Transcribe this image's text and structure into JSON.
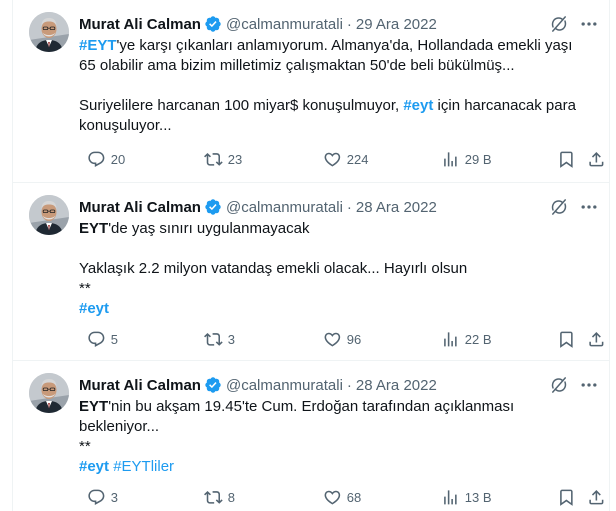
{
  "tweets": [
    {
      "name": "Murat Ali Calman",
      "handle": "@calmanmuratali",
      "separator": "·",
      "date": "29 Ara 2022",
      "body": {
        "l1_tag": "#EYT",
        "l1_rest": "'ye karşı çıkanları anlamıyorum. Almanya'da, Hollandada emekli yaşı",
        "l2": "65 olabilir ama bizim milletimiz çalışmaktan 50'de beli bükülmüş...",
        "l3": "Suriyelilere harcanan 100 miyar$ konuşulmuyor, ",
        "l3_tag": "#eyt",
        "l3_rest": " için harcanacak para",
        "l4": "konuşuluyor..."
      },
      "replies": "20",
      "retweets": "23",
      "likes": "224",
      "views": "29 B"
    },
    {
      "name": "Murat Ali Calman",
      "handle": "@calmanmuratali",
      "separator": "·",
      "date": "28 Ara 2022",
      "body": {
        "l1_bold": "EYT",
        "l1_rest": "'de yaş sınırı uygulanmayacak",
        "l2": "Yaklaşık 2.2 milyon vatandaş emekli olacak... Hayırlı olsun",
        "l3": "**",
        "l4_tag": "#eyt"
      },
      "replies": "5",
      "retweets": "3",
      "likes": "96",
      "views": "22 B"
    },
    {
      "name": "Murat Ali Calman",
      "handle": "@calmanmuratali",
      "separator": "·",
      "date": "28 Ara 2022",
      "body": {
        "l1_bold": "EYT",
        "l1_rest": "'nin bu akşam 19.45'te Cum. Erdoğan tarafından açıklanması",
        "l2": "bekleniyor...",
        "l3": "**",
        "l4_tag1": "#eyt",
        "l4_tag2": "#EYTliler"
      },
      "replies": "3",
      "retweets": "8",
      "likes": "68",
      "views": "13 B"
    }
  ],
  "colors": {
    "text": "#0f1419",
    "secondary": "#536471",
    "link": "#1d9bf0",
    "divider": "#eff3f4",
    "verified": "#1d9bf0"
  },
  "icons": [
    "verified-badge-icon",
    "grok-icon",
    "more-icon",
    "reply-icon",
    "retweet-icon",
    "like-icon",
    "views-icon",
    "bookmark-icon",
    "share-icon"
  ]
}
